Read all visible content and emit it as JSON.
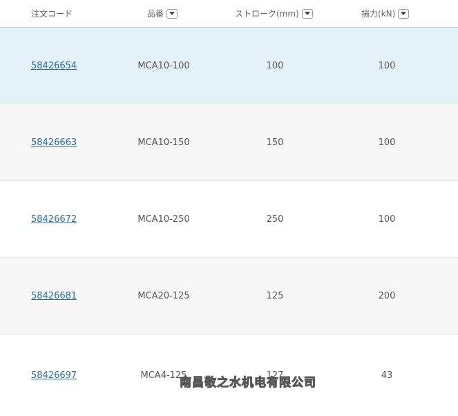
{
  "table": {
    "headers": {
      "code": "注文コード",
      "part": "品番",
      "stroke": "ストローク(mm)",
      "force": "揚力(kN)"
    },
    "rows": [
      {
        "code": "58426654",
        "part": "MCA10-100",
        "stroke": "100",
        "force": "100",
        "selected": true
      },
      {
        "code": "58426663",
        "part": "MCA10-150",
        "stroke": "150",
        "force": "100"
      },
      {
        "code": "58426672",
        "part": "MCA10-250",
        "stroke": "250",
        "force": "100"
      },
      {
        "code": "58426681",
        "part": "MCA20-125",
        "stroke": "125",
        "force": "200"
      },
      {
        "code": "58426697",
        "part": "MCA4-125",
        "stroke": "127",
        "force": "43"
      }
    ]
  },
  "watermark": "南昌敬之水机电有限公司",
  "colors": {
    "link": "#2a6ea5",
    "selected_row": "#e4f1f9",
    "alt_row": "#f7f7f7"
  }
}
